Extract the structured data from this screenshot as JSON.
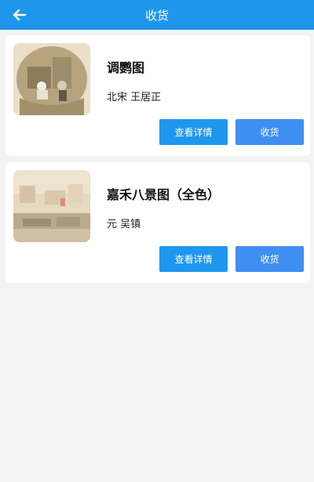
{
  "header": {
    "title": "收货",
    "back_icon": "back-arrow-icon"
  },
  "items": [
    {
      "title": "调鹦图",
      "subtitle": "北宋 王居正",
      "detail_label": "查看详情",
      "receive_label": "收货"
    },
    {
      "title": "嘉禾八景图（全色）",
      "subtitle": "元 吴镇",
      "detail_label": "查看详情",
      "receive_label": "收货"
    }
  ],
  "colors": {
    "header": "#1f96ee",
    "button_primary": "#1f96ee",
    "button_receive": "#3f8ff2",
    "background": "#f3f3f3"
  }
}
